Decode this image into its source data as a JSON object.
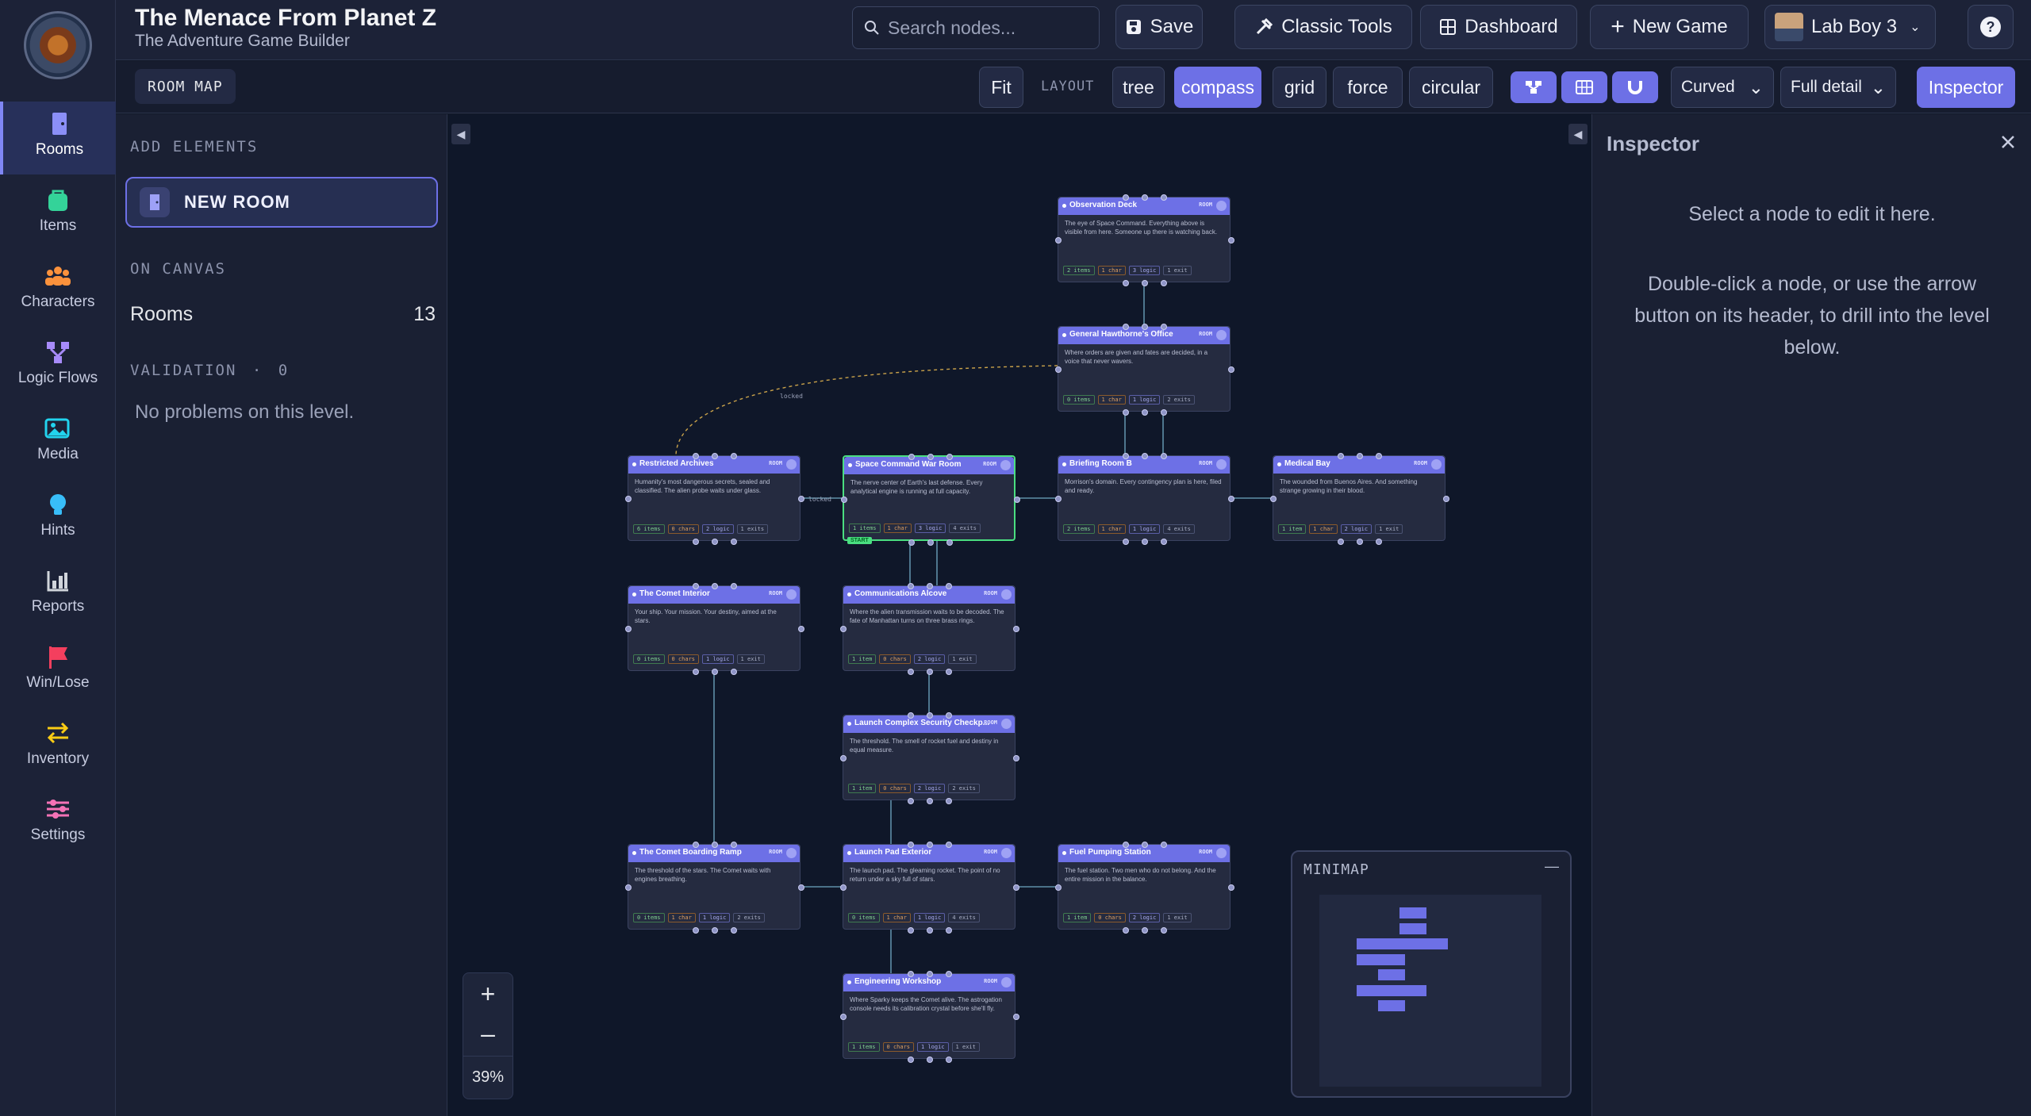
{
  "app": {
    "title": "The Menace From Planet Z",
    "subtitle": "The Adventure Game Builder"
  },
  "topbar": {
    "search_placeholder": "Search nodes...",
    "save": "Save",
    "classic_tools": "Classic Tools",
    "dashboard": "Dashboard",
    "new_game": "New Game",
    "user": "Lab Boy 3",
    "help": "?"
  },
  "rail": [
    {
      "label": "Rooms",
      "icon": "door-icon",
      "color": "#8b8ff7",
      "active": true
    },
    {
      "label": "Items",
      "icon": "bag-icon",
      "color": "#34d399"
    },
    {
      "label": "Characters",
      "icon": "people-icon",
      "color": "#fb923c"
    },
    {
      "label": "Logic Flows",
      "icon": "flow-icon",
      "color": "#a78bfa"
    },
    {
      "label": "Media",
      "icon": "image-icon",
      "color": "#22d3ee"
    },
    {
      "label": "Hints",
      "icon": "bulb-icon",
      "color": "#38bdf8"
    },
    {
      "label": "Reports",
      "icon": "chart-icon",
      "color": "#d1d5db"
    },
    {
      "label": "Win/Lose",
      "icon": "flag-icon",
      "color": "#f43f5e"
    },
    {
      "label": "Inventory",
      "icon": "swap-icon",
      "color": "#facc15"
    },
    {
      "label": "Settings",
      "icon": "sliders-icon",
      "color": "#f472b6"
    }
  ],
  "subbar": {
    "room_map": "ROOM MAP",
    "fit": "Fit",
    "layout_label": "LAYOUT",
    "layouts": [
      "tree",
      "compass",
      "grid",
      "force",
      "circular"
    ],
    "active_layout": "compass",
    "edge_style": "Curved",
    "detail": "Full detail",
    "inspector": "Inspector"
  },
  "left": {
    "add_elements": "ADD ELEMENTS",
    "new_room": "NEW ROOM",
    "on_canvas": "ON CANVAS",
    "rooms_label": "Rooms",
    "rooms_count": "13",
    "validation": "VALIDATION",
    "validation_sep": "·",
    "validation_count": "0",
    "no_problems": "No problems on this level."
  },
  "inspector": {
    "title": "Inspector",
    "line1": "Select a node to edit it here.",
    "line2": "Double-click a node, or use the arrow button on its header, to drill into the level below."
  },
  "canvas": {
    "zoom": "39%",
    "locked": "locked",
    "start": "START",
    "room_tag": "ROOM"
  },
  "minimap": {
    "title": "MINIMAP",
    "minimize": "—"
  },
  "nodes": [
    {
      "id": "obs",
      "name": "Observation Deck",
      "desc": "The eye of Space Command. Everything above is visible from here. Someone up there is watching back.",
      "tags": [
        "2 items",
        "1 char",
        "3 logic",
        "1 exit"
      ]
    },
    {
      "id": "gen",
      "name": "General Hawthorne's Office",
      "desc": "Where orders are given and fates are decided, in a voice that never wavers.",
      "tags": [
        "0 items",
        "1 char",
        "1 logic",
        "2 exits"
      ]
    },
    {
      "id": "arc",
      "name": "Restricted Archives",
      "desc": "Humanity's most dangerous secrets, sealed and classified. The alien probe waits under glass.",
      "tags": [
        "6 items",
        "0 chars",
        "2 logic",
        "1 exits"
      ]
    },
    {
      "id": "war",
      "name": "Space Command War Room",
      "desc": "The nerve center of Earth's last defense. Every analytical engine is running at full capacity.",
      "tags": [
        "1 items",
        "1 char",
        "3 logic",
        "4 exits"
      ]
    },
    {
      "id": "bri",
      "name": "Briefing Room B",
      "desc": "Morrison's domain. Every contingency plan is here, filed and ready.",
      "tags": [
        "2 items",
        "1 char",
        "1 logic",
        "4 exits"
      ]
    },
    {
      "id": "med",
      "name": "Medical Bay",
      "desc": "The wounded from Buenos Aires. And something strange growing in their blood.",
      "tags": [
        "1 item",
        "1 char",
        "2 logic",
        "1 exit"
      ]
    },
    {
      "id": "cmi",
      "name": "The Comet Interior",
      "desc": "Your ship. Your mission. Your destiny, aimed at the stars.",
      "tags": [
        "0 items",
        "0 chars",
        "1 logic",
        "1 exit"
      ]
    },
    {
      "id": "com",
      "name": "Communications Alcove",
      "desc": "Where the alien transmission waits to be decoded. The fate of Manhattan turns on three brass rings.",
      "tags": [
        "1 item",
        "0 chars",
        "2 logic",
        "1 exit"
      ]
    },
    {
      "id": "lcs",
      "name": "Launch Complex Security Checkp...",
      "desc": "The threshold. The smell of rocket fuel and destiny in equal measure.",
      "tags": [
        "1 item",
        "0 chars",
        "2 logic",
        "2 exits"
      ]
    },
    {
      "id": "cbr",
      "name": "The Comet Boarding Ramp",
      "desc": "The threshold of the stars. The Comet waits with engines breathing.",
      "tags": [
        "0 items",
        "1 char",
        "1 logic",
        "2 exits"
      ]
    },
    {
      "id": "lpe",
      "name": "Launch Pad Exterior",
      "desc": "The launch pad. The gleaming rocket. The point of no return under a sky full of stars.",
      "tags": [
        "0 items",
        "1 char",
        "1 logic",
        "4 exits"
      ]
    },
    {
      "id": "fps",
      "name": "Fuel Pumping Station",
      "desc": "The fuel station. Two men who do not belong. And the entire mission in the balance.",
      "tags": [
        "1 item",
        "0 chars",
        "2 logic",
        "1 exit"
      ]
    },
    {
      "id": "eng",
      "name": "Engineering Workshop",
      "desc": "Where Sparky keeps the Comet alive. The astrogation console needs its calibration crystal before she'll fly.",
      "tags": [
        "1 items",
        "0 chars",
        "1 logic",
        "1 exit"
      ]
    }
  ],
  "colors": {
    "accent": "#6d70e6",
    "start": "#4ade80",
    "canvas": "#0f1729"
  }
}
